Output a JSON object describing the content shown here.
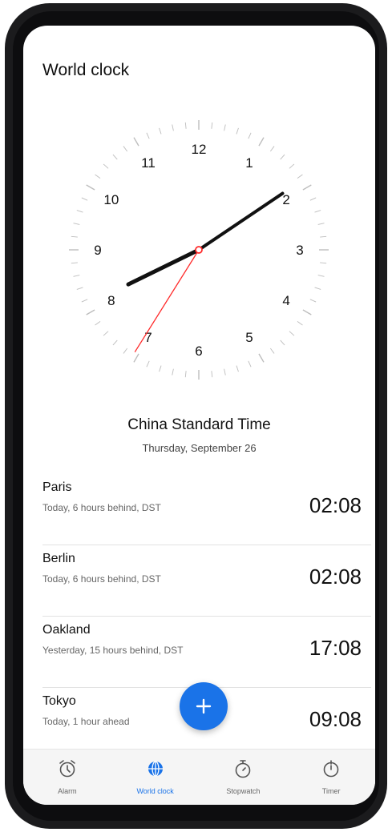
{
  "header": {
    "title": "World clock"
  },
  "clock": {
    "numerals": [
      "12",
      "1",
      "2",
      "3",
      "4",
      "5",
      "6",
      "7",
      "8",
      "9",
      "10",
      "11"
    ],
    "hour_hand_hour": 8.13,
    "minute_hand_minute": 8,
    "second_hand_second": 36
  },
  "home_zone": {
    "name": "China Standard Time",
    "date": "Thursday, September 26"
  },
  "cities": [
    {
      "name": "Paris",
      "desc": "Today, 6 hours behind, DST",
      "time": "02:08"
    },
    {
      "name": "Berlin",
      "desc": "Today, 6 hours behind, DST",
      "time": "02:08"
    },
    {
      "name": "Oakland",
      "desc": "Yesterday, 15 hours behind, DST",
      "time": "17:08"
    },
    {
      "name": "Tokyo",
      "desc": "Today, 1 hour ahead",
      "time": "09:08"
    }
  ],
  "tabs": [
    {
      "label": "Alarm",
      "icon": "alarm-clock-icon",
      "active": false
    },
    {
      "label": "World clock",
      "icon": "globe-icon",
      "active": true
    },
    {
      "label": "Stopwatch",
      "icon": "stopwatch-icon",
      "active": false
    },
    {
      "label": "Timer",
      "icon": "timer-icon",
      "active": false
    }
  ],
  "colors": {
    "accent": "#1a73e8",
    "second_hand": "#ff2a2a"
  }
}
